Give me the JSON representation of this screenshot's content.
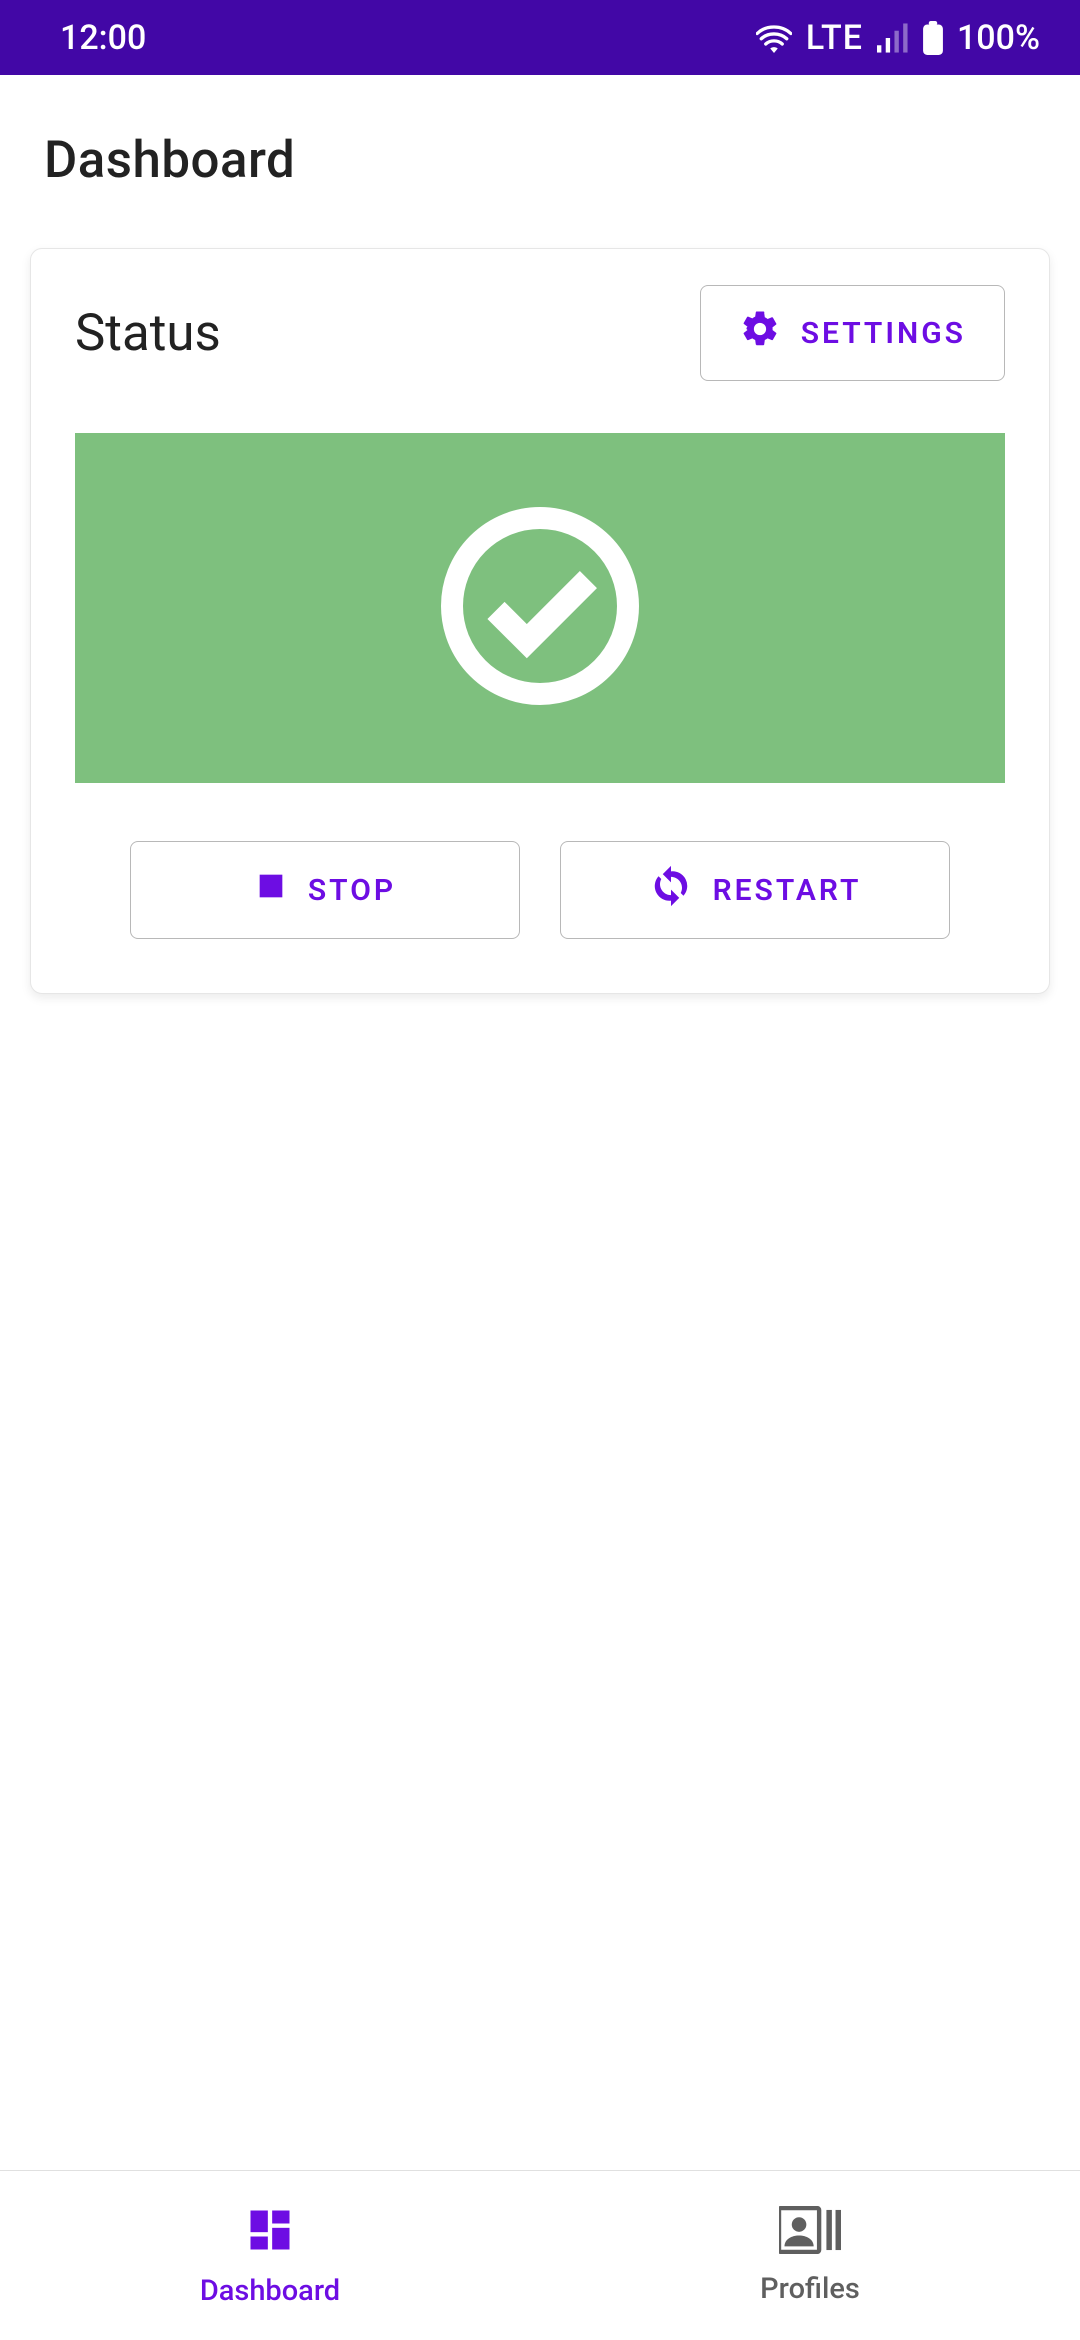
{
  "statusbar": {
    "time": "12:00",
    "network_label": "LTE",
    "battery": "100%"
  },
  "page": {
    "title": "Dashboard"
  },
  "card": {
    "title": "Status",
    "settings_label": "SETTINGS",
    "stop_label": "STOP",
    "restart_label": "RESTART"
  },
  "colors": {
    "brand_primary": "#4207A6",
    "accent": "#6D0DE3",
    "status_ok_bg": "#7EC07E"
  },
  "bottom_nav": {
    "items": [
      {
        "label": "Dashboard",
        "active": true
      },
      {
        "label": "Profiles",
        "active": false
      }
    ]
  }
}
